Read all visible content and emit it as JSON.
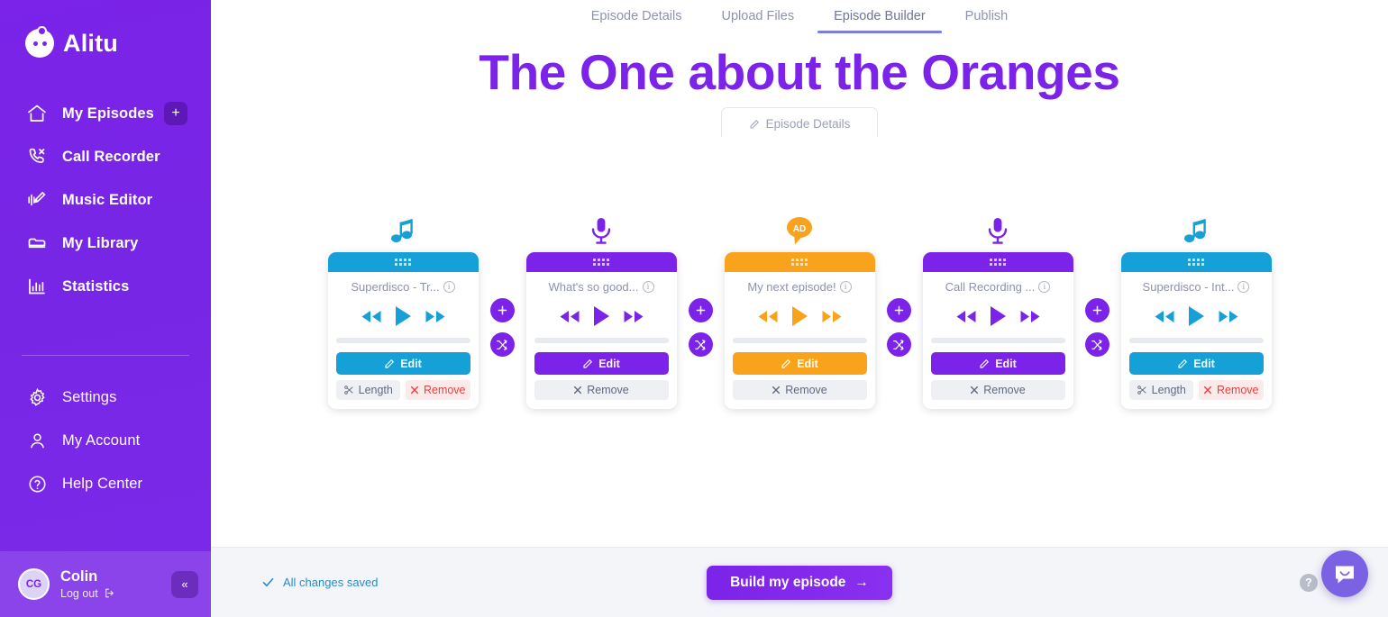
{
  "brand": {
    "name": "Alitu"
  },
  "sidebar": {
    "primary_items": [
      {
        "label": "My Episodes",
        "icon": "home-icon",
        "has_add": true
      },
      {
        "label": "Call Recorder",
        "icon": "phone-icon",
        "has_add": false
      },
      {
        "label": "Music Editor",
        "icon": "music-edit-icon",
        "has_add": false
      },
      {
        "label": "My Library",
        "icon": "library-icon",
        "has_add": false
      },
      {
        "label": "Statistics",
        "icon": "chart-icon",
        "has_add": false
      }
    ],
    "secondary_items": [
      {
        "label": "Settings",
        "icon": "gear-icon"
      },
      {
        "label": "My Account",
        "icon": "user-icon"
      },
      {
        "label": "Help Center",
        "icon": "question-circle-icon"
      }
    ],
    "add_episode_label": "+",
    "user": {
      "initials": "CG",
      "name": "Colin",
      "logout_label": "Log out"
    },
    "collapse_label": "«"
  },
  "tabs": [
    {
      "label": "Episode Details",
      "active": false
    },
    {
      "label": "Upload Files",
      "active": false
    },
    {
      "label": "Episode Builder",
      "active": true
    },
    {
      "label": "Publish",
      "active": false
    }
  ],
  "header": {
    "title": "The One about the Oranges",
    "subtitle": "Episode Details"
  },
  "connector": {
    "add_label": "+",
    "shuffle_name": "crossfade-icon"
  },
  "labels": {
    "edit": "Edit",
    "length": "Length",
    "remove": "Remove",
    "info": "i"
  },
  "cards": [
    {
      "title": "Superdisco - Tr...",
      "type_icon": "music-note-icon",
      "color": "#16a0d8",
      "edit_color": "#16a0d8",
      "has_length": true
    },
    {
      "title": "What's so good...",
      "type_icon": "microphone-icon",
      "color": "#7b23e8",
      "edit_color": "#7b23e8",
      "has_length": false
    },
    {
      "title": "My next episode!",
      "type_icon": "ad-bubble-icon",
      "color": "#f9a21b",
      "edit_color": "#f9a21b",
      "has_length": false,
      "badge_text": "AD"
    },
    {
      "title": "Call Recording ...",
      "type_icon": "microphone-icon",
      "color": "#7b23e8",
      "edit_color": "#7b23e8",
      "has_length": false
    },
    {
      "title": "Superdisco - Int...",
      "type_icon": "music-note-icon",
      "color": "#16a0d8",
      "edit_color": "#16a0d8",
      "has_length": true
    }
  ],
  "footer": {
    "saved_text": "All changes saved",
    "build_label": "Build my episode",
    "build_arrow": "→",
    "help_label": "?"
  },
  "colors": {
    "brand_purple": "#7b23e8",
    "blue": "#16a0d8",
    "orange": "#f9a21b",
    "danger": "#e3423f",
    "tab_active_underline": "#7b7ce0"
  }
}
